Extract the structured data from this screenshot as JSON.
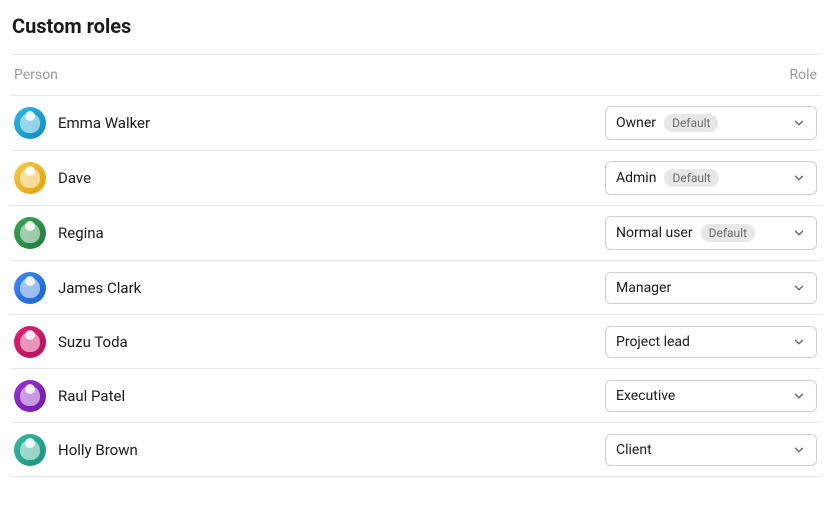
{
  "title": "Custom roles",
  "columns": {
    "person": "Person",
    "role": "Role"
  },
  "badge_default": "Default",
  "people": [
    {
      "name": "Emma Walker",
      "role": "Owner",
      "is_default": true,
      "avatar_colors": [
        "#29b8e8",
        "#0e8bbd"
      ]
    },
    {
      "name": "Dave",
      "role": "Admin",
      "is_default": true,
      "avatar_colors": [
        "#f7c948",
        "#e0a106"
      ]
    },
    {
      "name": "Regina",
      "role": "Normal user",
      "is_default": true,
      "avatar_colors": [
        "#3aa655",
        "#1f7a3a"
      ]
    },
    {
      "name": "James Clark",
      "role": "Manager",
      "is_default": false,
      "avatar_colors": [
        "#3d8bfd",
        "#1a5fcc"
      ]
    },
    {
      "name": "Suzu Toda",
      "role": "Project lead",
      "is_default": false,
      "avatar_colors": [
        "#e71d73",
        "#b01256"
      ]
    },
    {
      "name": "Raul Patel",
      "role": "Executive",
      "is_default": false,
      "avatar_colors": [
        "#9b2fd9",
        "#6f1aa6"
      ]
    },
    {
      "name": "Holly Brown",
      "role": "Client",
      "is_default": false,
      "avatar_colors": [
        "#2fbfa0",
        "#1a8f77"
      ]
    }
  ]
}
